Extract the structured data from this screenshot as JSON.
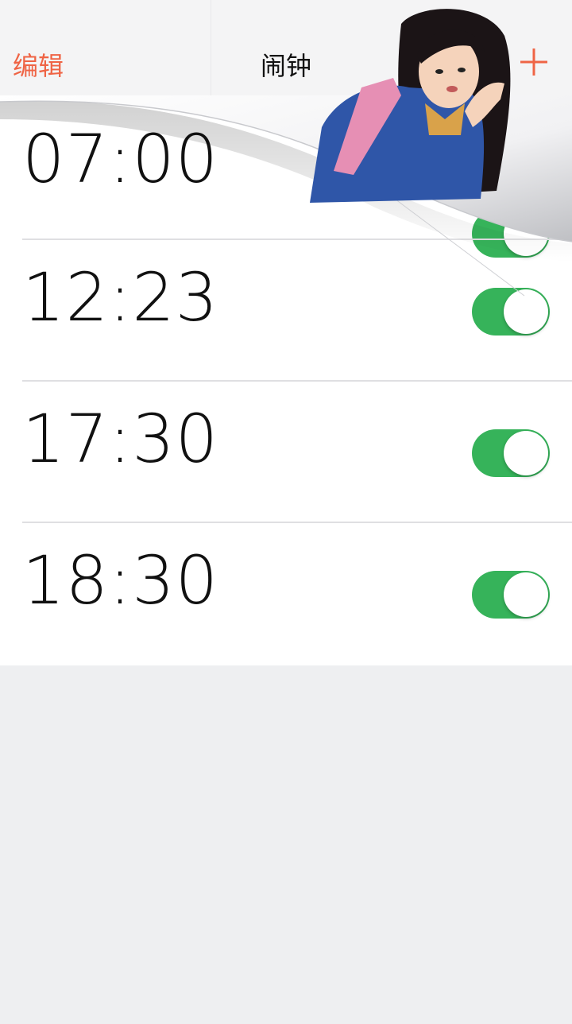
{
  "nav": {
    "edit_label": "编辑",
    "title": "闹钟",
    "add_icon": "plus-icon"
  },
  "alarms": [
    {
      "time": "07:00",
      "enabled": true
    },
    {
      "time": "12:23",
      "enabled": true
    },
    {
      "time": "17:30",
      "enabled": true
    },
    {
      "time": "18:30",
      "enabled": true
    }
  ],
  "colors": {
    "accent": "#ef6445",
    "toggle_on": "#36b35a",
    "background": "#eeeff1",
    "navbar": "#f4f4f5"
  },
  "overlay": {
    "description_icon": "page-curl-sticker-girl"
  }
}
